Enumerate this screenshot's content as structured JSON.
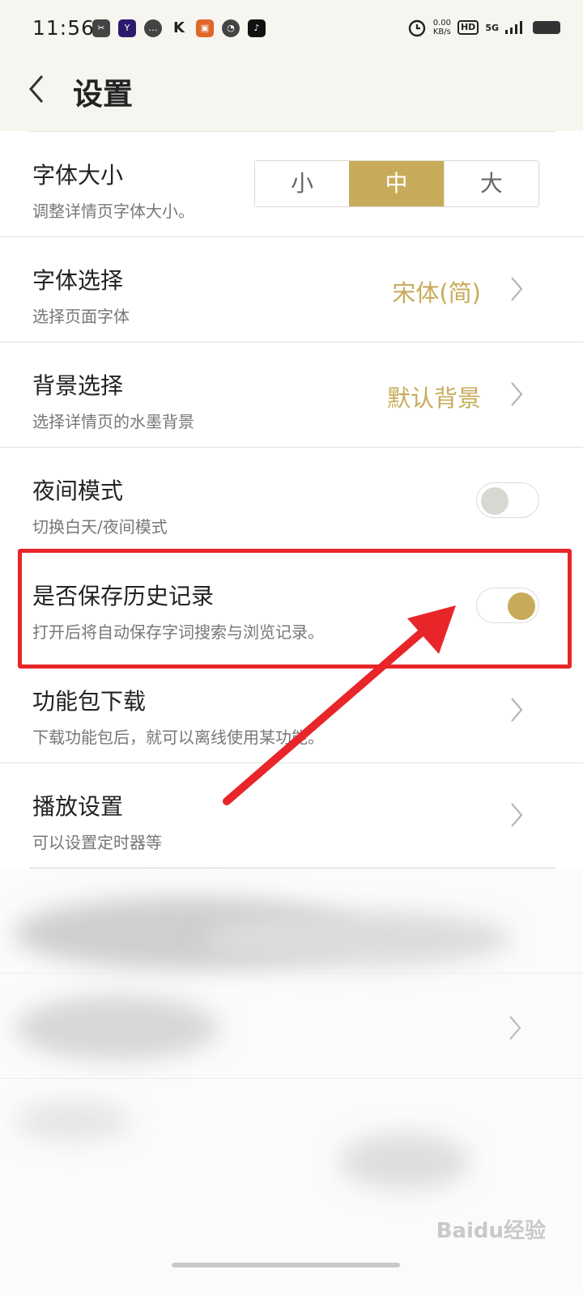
{
  "status_bar": {
    "time": "11:56",
    "net_speed_value": "0.00",
    "net_speed_unit": "KB/s",
    "hd": "HD",
    "signal": "5G"
  },
  "header": {
    "title": "设置"
  },
  "settings": {
    "font_size": {
      "title": "字体大小",
      "subtitle": "调整详情页字体大小。",
      "options": [
        "小",
        "中",
        "大"
      ],
      "selected": "中"
    },
    "font_choice": {
      "title": "字体选择",
      "subtitle": "选择页面字体",
      "value": "宋体(简)"
    },
    "background_choice": {
      "title": "背景选择",
      "subtitle": "选择详情页的水墨背景",
      "value": "默认背景"
    },
    "night_mode": {
      "title": "夜间模式",
      "subtitle": "切换白天/夜间模式",
      "enabled": false
    },
    "save_history": {
      "title": "是否保存历史记录",
      "subtitle": "打开后将自动保存字词搜索与浏览记录。",
      "enabled": true
    },
    "feature_pack": {
      "title": "功能包下载",
      "subtitle": "下载功能包后，就可以离线使用某功能。"
    },
    "playback": {
      "title": "播放设置",
      "subtitle": "可以设置定时器等"
    }
  },
  "colors": {
    "accent": "#c8ab5a",
    "annotation_red": "#e8262a",
    "header_bg": "#f7f5f0"
  },
  "watermark": "Baidu经验"
}
